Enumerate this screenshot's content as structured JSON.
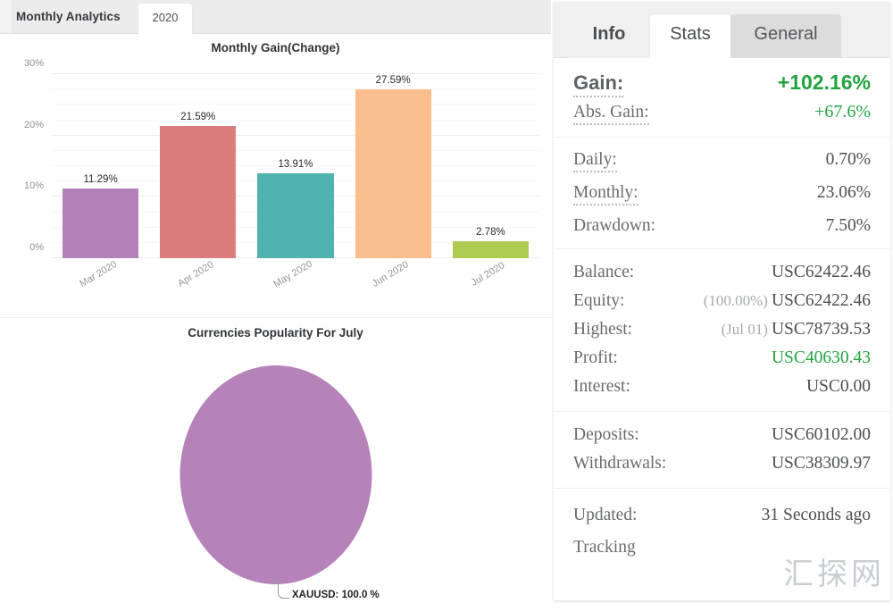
{
  "left": {
    "panel_title": "Monthly Analytics",
    "year_tab": "2020"
  },
  "chart_data": [
    {
      "type": "bar",
      "title": "Monthly Gain(Change)",
      "xlabel": "",
      "ylabel": "",
      "ylim": [
        0,
        30
      ],
      "yticks": [
        "0%",
        "10%",
        "20%",
        "30%"
      ],
      "grid": true,
      "legend": "none",
      "categories": [
        "Mar 2020",
        "Apr 2020",
        "May 2020",
        "Jun 2020",
        "Jul 2020"
      ],
      "values": [
        11.29,
        21.59,
        13.91,
        27.59,
        2.78
      ],
      "data_labels": [
        "11.29%",
        "21.59%",
        "13.91%",
        "27.59%",
        "2.78%"
      ],
      "colors": [
        "#b281b7",
        "#dd7c7c",
        "#4fb3b0",
        "#fbbd8b",
        "#aecd50"
      ]
    },
    {
      "type": "pie",
      "title": "Currencies Popularity For July",
      "labels": [
        "XAUUSD"
      ],
      "values": [
        100.0
      ],
      "data_labels": [
        "XAUUSD: 100.0 %"
      ],
      "colors": [
        "#b583ba"
      ]
    }
  ],
  "panel": {
    "tabs": [
      {
        "label": "Info",
        "active": false
      },
      {
        "label": "Stats",
        "active": true
      },
      {
        "label": "General",
        "active": false
      }
    ],
    "groups": [
      {
        "rows": [
          {
            "label": "Gain:",
            "value": "+102.16%"
          },
          {
            "label": "Abs. Gain:",
            "value": "+67.6%"
          }
        ]
      },
      {
        "rows": [
          {
            "label": "Daily:",
            "value": "0.70%"
          },
          {
            "label": "Monthly:",
            "value": "23.06%"
          },
          {
            "label": "Drawdown:",
            "value": "7.50%"
          }
        ]
      },
      {
        "rows": [
          {
            "label": "Balance:",
            "value": "USC62422.46"
          },
          {
            "label": "Equity:",
            "sub": "(100.00%)",
            "value": "USC62422.46"
          },
          {
            "label": "Highest:",
            "sub": "(Jul 01)",
            "value": "USC78739.53"
          },
          {
            "label": "Profit:",
            "value": "USC40630.43"
          },
          {
            "label": "Interest:",
            "value": "USC0.00"
          }
        ]
      },
      {
        "rows": [
          {
            "label": "Deposits:",
            "value": "USC60102.00"
          },
          {
            "label": "Withdrawals:",
            "value": "USC38309.97"
          }
        ]
      },
      {
        "rows": [
          {
            "label": "Updated:",
            "value": "31 Seconds ago"
          },
          {
            "label": "Tracking",
            "value": ""
          }
        ]
      }
    ]
  },
  "watermark": "汇探网",
  "colors": {
    "positive": "#22a340",
    "tab_active": "#ffffff",
    "tab_inactive": "#dcdcdc"
  }
}
